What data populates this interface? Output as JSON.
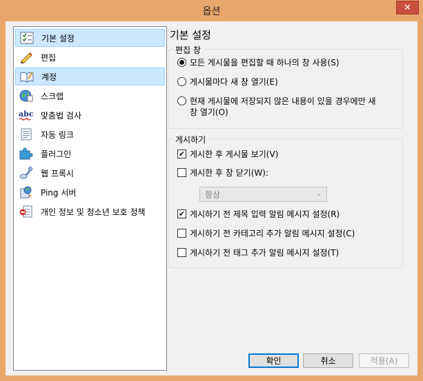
{
  "window": {
    "title": "옵션",
    "close_symbol": "✕"
  },
  "sidebar": {
    "items": [
      {
        "label": "기본 설정",
        "icon": "checklist-icon"
      },
      {
        "label": "편집",
        "icon": "pencil-icon"
      },
      {
        "label": "계정",
        "icon": "book-pen-icon"
      },
      {
        "label": "스크랩",
        "icon": "globe-icon"
      },
      {
        "label": "맞춤법 검사",
        "icon": "spellcheck-icon"
      },
      {
        "label": "자동 링크",
        "icon": "document-icon"
      },
      {
        "label": "플러그인",
        "icon": "puzzle-icon"
      },
      {
        "label": "웹 프록시",
        "icon": "proxy-icon"
      },
      {
        "label": "Ping 서버",
        "icon": "ping-icon"
      },
      {
        "label": "개인 정보 및 청소년 보호 정책",
        "icon": "privacy-icon"
      }
    ],
    "selected": "기본 설정",
    "highlight_color": "#cce8ff"
  },
  "main": {
    "title": "기본 설정",
    "edit_window_group": {
      "legend": "편집 창",
      "options": [
        {
          "label": "모든 게시물을 편집할 때 하나의 창 사용(S)",
          "selected": true
        },
        {
          "label": "게시물마다 새 창 열기(E)",
          "selected": false
        },
        {
          "label": "현재 게시물에 저장되지 않은 내용이 있을 경우에만 새",
          "label_line2": "창 열기(O)",
          "selected": false
        }
      ]
    },
    "publish_group": {
      "legend": "게시하기",
      "options": [
        {
          "label": "게시한 후 게시물 보기(V)",
          "checked": true
        },
        {
          "label": "게시한 후 창 닫기(W):",
          "checked": false
        },
        {
          "label": "게시하기 전 제목 입력 알림 메시지 설정(R)",
          "checked": true
        },
        {
          "label": "게시하기 전 카테고리 추가 알림 메시지 설정(C)",
          "checked": false
        },
        {
          "label": "게시하기 전 태그 추가 알림 메시지 설정(T)",
          "checked": false
        }
      ],
      "close_after_select": {
        "value": "항상",
        "disabled": true
      }
    }
  },
  "buttons": {
    "ok": "확인",
    "cancel": "취소",
    "apply": "적용(A)"
  },
  "colors": {
    "frame": "#e9a66b",
    "close": "#c7503f",
    "focus": "#0078d7"
  }
}
